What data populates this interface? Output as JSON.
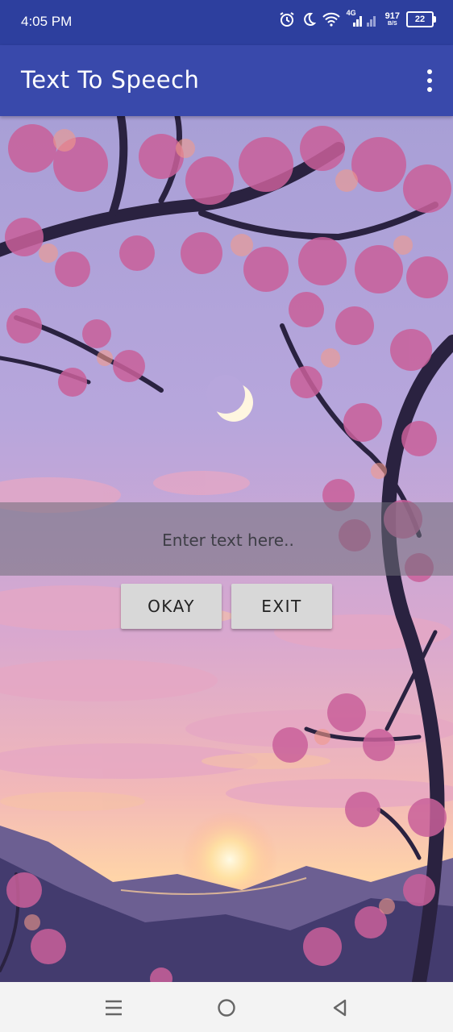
{
  "status_bar": {
    "time": "4:05 PM",
    "network_type": "4G",
    "net_speed_value": "917",
    "net_speed_unit": "B/S",
    "battery_level": "22"
  },
  "app_bar": {
    "title": "Text To Speech"
  },
  "form": {
    "input_placeholder": "Enter text here..",
    "input_value": "",
    "okay_label": "OKAY",
    "exit_label": "EXIT"
  },
  "colors": {
    "status_bar": "#2d3f9e",
    "app_bar": "#3949ab",
    "button_bg": "#d8d8d8"
  },
  "icons": {
    "alarm": "alarm-icon",
    "dnd": "moon-icon",
    "wifi": "wifi-icon",
    "signal": "signal-icon",
    "menu": "more-vert-icon",
    "nav_recent": "recent-apps-icon",
    "nav_home": "home-icon",
    "nav_back": "back-icon"
  }
}
